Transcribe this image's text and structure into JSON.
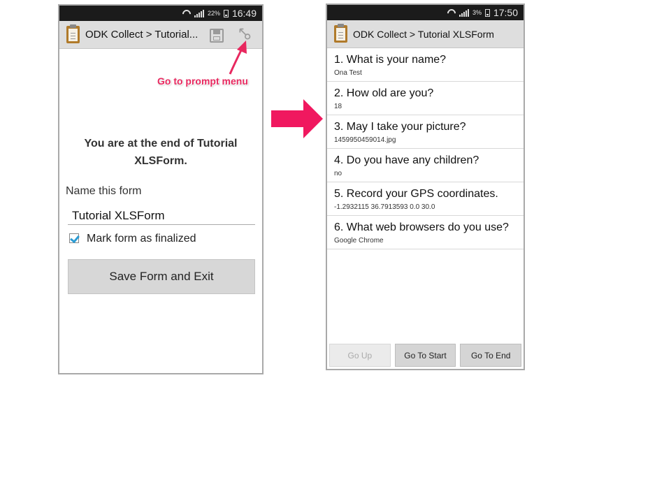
{
  "left_screen": {
    "status": {
      "battery_pct": "22%",
      "time": "16:49"
    },
    "app_title": "ODK Collect > Tutorial...",
    "annotation": "Go to prompt menu",
    "end_message": "You are at the end of Tutorial XLSForm.",
    "name_label": "Name this form",
    "name_value": "Tutorial XLSForm",
    "finalized_label": "Mark form as finalized",
    "finalized_checked": true,
    "save_button": "Save Form and Exit"
  },
  "right_screen": {
    "status": {
      "battery_pct": "3%",
      "time": "17:50"
    },
    "app_title": "ODK Collect > Tutorial XLSForm",
    "questions": [
      {
        "title": "1. What is your name?",
        "answer": "Ona Test"
      },
      {
        "title": "2. How old are you?",
        "answer": "18"
      },
      {
        "title": "3. May I take your picture?",
        "answer": "1459950459014.jpg"
      },
      {
        "title": "4. Do you have any children?",
        "answer": "no"
      },
      {
        "title": "5. Record your GPS coordinates.",
        "answer": "-1.2932115 36.7913593 0.0 30.0"
      },
      {
        "title": "6. What web browsers do you use?",
        "answer": "Google Chrome"
      }
    ],
    "nav": {
      "up": "Go Up",
      "start": "Go To Start",
      "end": "Go To End"
    }
  },
  "colors": {
    "annotation": "#e8285f",
    "arrow": "#f0185f",
    "checkbox": "#2a9bd3"
  },
  "icons": [
    "wifi-icon",
    "signal-icon",
    "battery-icon",
    "clipboard-icon",
    "save-icon",
    "prompt-menu-icon",
    "right-arrow-icon"
  ]
}
